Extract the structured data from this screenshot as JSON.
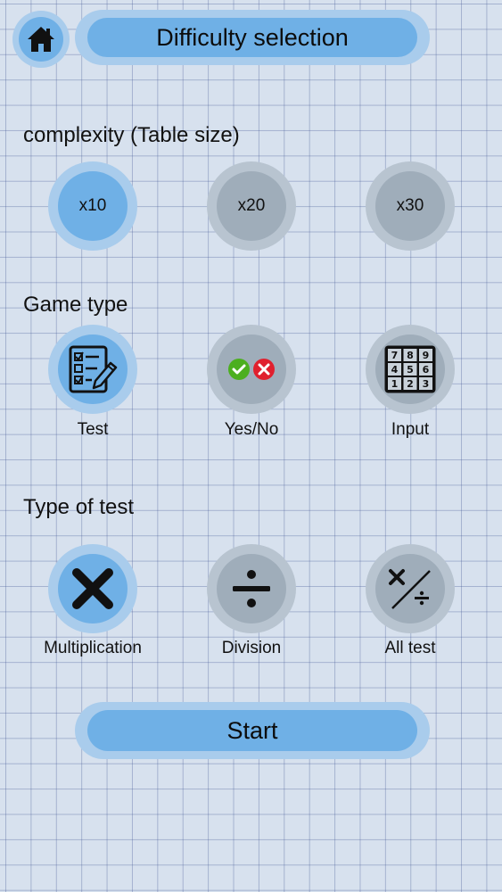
{
  "header": {
    "home_icon": "home-icon",
    "title": "Difficulty selection"
  },
  "complexity": {
    "title": "complexity (Table size)",
    "options": [
      {
        "label": "x10",
        "selected": true
      },
      {
        "label": "x20",
        "selected": false
      },
      {
        "label": "x30",
        "selected": false
      }
    ]
  },
  "game_type": {
    "title": "Game type",
    "options": [
      {
        "label": "Test",
        "icon": "checklist-pencil-icon",
        "selected": true
      },
      {
        "label": "Yes/No",
        "icon": "check-cross-icon",
        "selected": false
      },
      {
        "label": "Input",
        "icon": "number-keypad-icon",
        "selected": false
      }
    ],
    "keypad_digits": [
      "7",
      "8",
      "9",
      "4",
      "5",
      "6",
      "1",
      "2",
      "3"
    ]
  },
  "test_type": {
    "title": "Type of test",
    "options": [
      {
        "label": "Multiplication",
        "icon": "multiply-icon",
        "selected": true
      },
      {
        "label": "Division",
        "icon": "divide-icon",
        "selected": false
      },
      {
        "label": "All test",
        "icon": "multiply-divide-icon",
        "selected": false
      }
    ]
  },
  "start_label": "Start",
  "colors": {
    "accent": "#6fb0e6",
    "accent_ring": "#a9ccec",
    "idle": "#9fadba",
    "idle_ring": "#b8c4d0",
    "check_green": "#4caf1f",
    "cross_red": "#e0202e"
  }
}
